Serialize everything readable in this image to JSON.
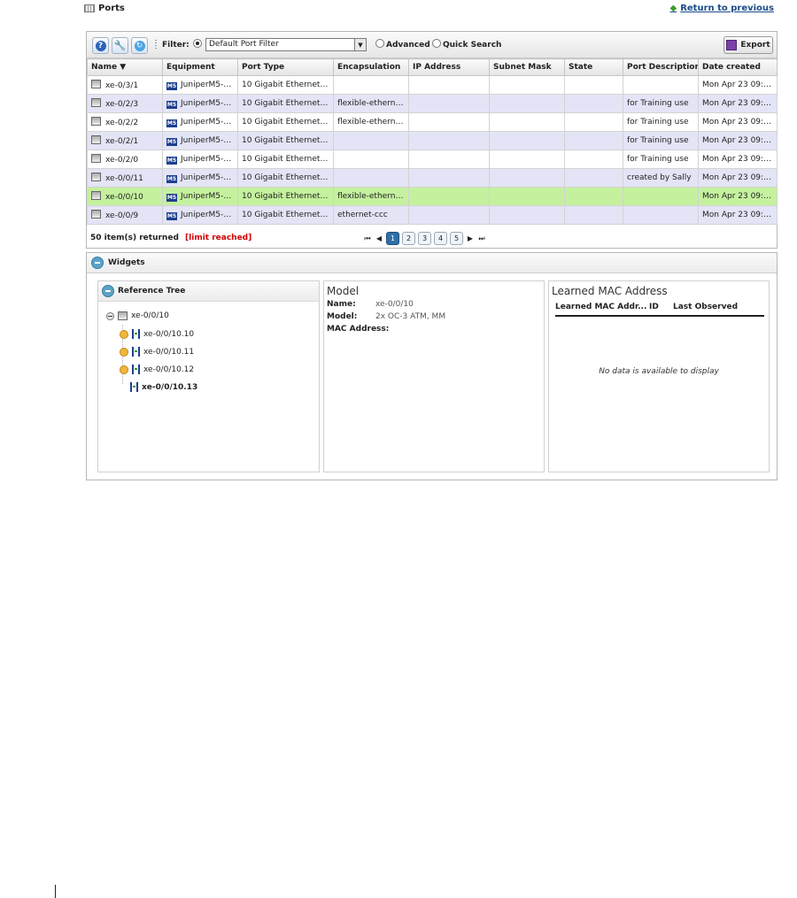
{
  "header": {
    "title": "Ports",
    "return_label": "Return to previous"
  },
  "toolbar": {
    "help": "?",
    "filter_label": "Filter:",
    "filter_value": "Default Port Filter",
    "advanced_label": "Advanced",
    "quick_search_label": "Quick Search",
    "export_label": "Export"
  },
  "table": {
    "columns": [
      "Name ▼",
      "Equipment",
      "Port Type",
      "Encapsulation",
      "IP Address",
      "Subnet Mask",
      "State",
      "Port Description",
      "Date created"
    ],
    "rows": [
      {
        "name": "xe-0/3/1",
        "equipment": "JuniperM5-1...",
        "port_type": "10 Gigabit Ethernet Op...",
        "encapsulation": "",
        "ip": "",
        "subnet": "",
        "state": "",
        "desc": "",
        "date": "Mon Apr 23 09:2..."
      },
      {
        "name": "xe-0/2/3",
        "equipment": "JuniperM5-1...",
        "port_type": "10 Gigabit Ethernet Op...",
        "encapsulation": "flexible-ethernet...",
        "ip": "",
        "subnet": "",
        "state": "",
        "desc": "for Training use",
        "date": "Mon Apr 23 09:2..."
      },
      {
        "name": "xe-0/2/2",
        "equipment": "JuniperM5-1...",
        "port_type": "10 Gigabit Ethernet Op...",
        "encapsulation": "flexible-ethernet...",
        "ip": "",
        "subnet": "",
        "state": "",
        "desc": "for Training use",
        "date": "Mon Apr 23 09:2..."
      },
      {
        "name": "xe-0/2/1",
        "equipment": "JuniperM5-1...",
        "port_type": "10 Gigabit Ethernet Op...",
        "encapsulation": "",
        "ip": "",
        "subnet": "",
        "state": "",
        "desc": "for Training use",
        "date": "Mon Apr 23 09:2..."
      },
      {
        "name": "xe-0/2/0",
        "equipment": "JuniperM5-1...",
        "port_type": "10 Gigabit Ethernet Op...",
        "encapsulation": "",
        "ip": "",
        "subnet": "",
        "state": "",
        "desc": "for Training use",
        "date": "Mon Apr 23 09:2..."
      },
      {
        "name": "xe-0/0/11",
        "equipment": "JuniperM5-1...",
        "port_type": "10 Gigabit Ethernet Op...",
        "encapsulation": "",
        "ip": "",
        "subnet": "",
        "state": "",
        "desc": "created by Sally",
        "date": "Mon Apr 23 09:2..."
      },
      {
        "name": "xe-0/0/10",
        "equipment": "JuniperM5-1...",
        "port_type": "10 Gigabit Ethernet Op...",
        "encapsulation": "flexible-ethernet...",
        "ip": "",
        "subnet": "",
        "state": "",
        "desc": "",
        "date": "Mon Apr 23 09:2..."
      },
      {
        "name": "xe-0/0/9",
        "equipment": "JuniperM5-1...",
        "port_type": "10 Gigabit Ethernet Op...",
        "encapsulation": "ethernet-ccc",
        "ip": "",
        "subnet": "",
        "state": "",
        "desc": "",
        "date": "Mon Apr 23 09:2..."
      }
    ],
    "selected_row": 6,
    "count_text": "50 item(s) returned",
    "limit_text": "[limit reached]",
    "pages": [
      "1",
      "2",
      "3",
      "4",
      "5"
    ],
    "current_page": "1"
  },
  "widgets": {
    "title": "Widgets",
    "reference_tree": {
      "title": "Reference Tree",
      "root": "xe-0/0/10",
      "children": [
        "xe-0/0/10.10",
        "xe-0/0/10.11",
        "xe-0/0/10.12",
        "xe-0/0/10.13"
      ]
    },
    "model": {
      "title": "Model",
      "name_key": "Name:",
      "name_val": "xe-0/0/10",
      "model_key": "Model:",
      "model_val": "2x OC-3 ATM, MM",
      "mac_key": "MAC Address:"
    },
    "learned_mac": {
      "title": "Learned MAC Address",
      "col1": "Learned MAC Addr...",
      "col2": "ID",
      "col3": "Last Observed",
      "no_data": "No data is available to display"
    }
  },
  "colors": {
    "selected_row": "#c5f19e",
    "alt_row": "#e3e4f6",
    "limit_red": "#d00000",
    "link_blue": "#1a4c8b"
  },
  "icons": {
    "port": "port-icon",
    "equipment": "m5-equipment-icon",
    "help": "help-icon",
    "wrench": "wrench-icon",
    "refresh": "refresh-icon",
    "export": "disk-icon"
  }
}
